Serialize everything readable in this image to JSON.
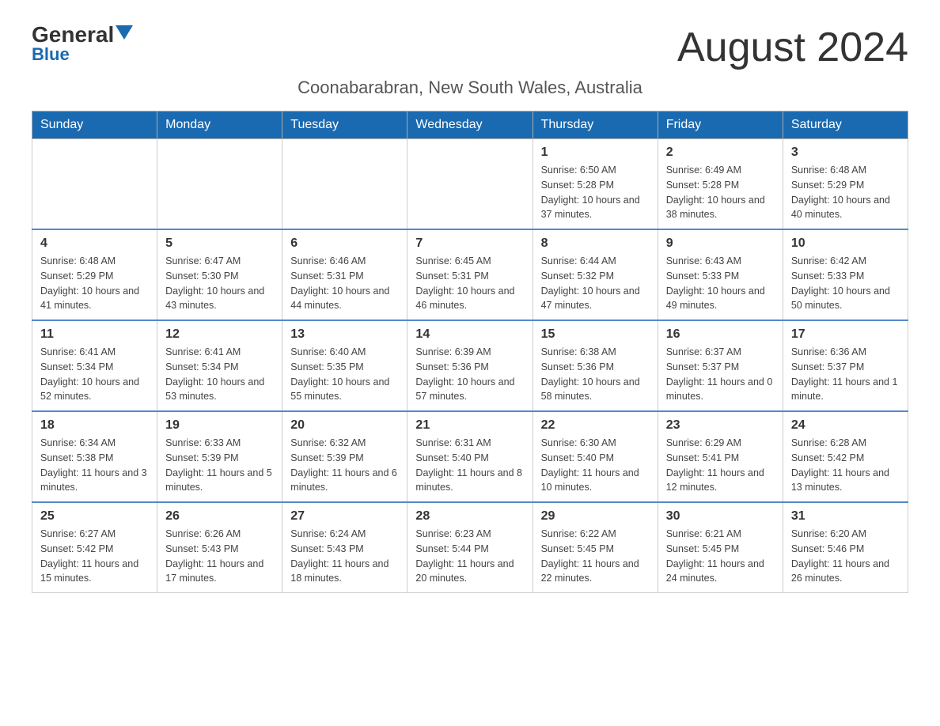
{
  "header": {
    "logo_general": "General",
    "logo_blue": "Blue",
    "month_title": "August 2024",
    "location": "Coonabarabran, New South Wales, Australia"
  },
  "days_of_week": [
    "Sunday",
    "Monday",
    "Tuesday",
    "Wednesday",
    "Thursday",
    "Friday",
    "Saturday"
  ],
  "weeks": [
    [
      {
        "day": "",
        "info": ""
      },
      {
        "day": "",
        "info": ""
      },
      {
        "day": "",
        "info": ""
      },
      {
        "day": "",
        "info": ""
      },
      {
        "day": "1",
        "info": "Sunrise: 6:50 AM\nSunset: 5:28 PM\nDaylight: 10 hours and 37 minutes."
      },
      {
        "day": "2",
        "info": "Sunrise: 6:49 AM\nSunset: 5:28 PM\nDaylight: 10 hours and 38 minutes."
      },
      {
        "day": "3",
        "info": "Sunrise: 6:48 AM\nSunset: 5:29 PM\nDaylight: 10 hours and 40 minutes."
      }
    ],
    [
      {
        "day": "4",
        "info": "Sunrise: 6:48 AM\nSunset: 5:29 PM\nDaylight: 10 hours and 41 minutes."
      },
      {
        "day": "5",
        "info": "Sunrise: 6:47 AM\nSunset: 5:30 PM\nDaylight: 10 hours and 43 minutes."
      },
      {
        "day": "6",
        "info": "Sunrise: 6:46 AM\nSunset: 5:31 PM\nDaylight: 10 hours and 44 minutes."
      },
      {
        "day": "7",
        "info": "Sunrise: 6:45 AM\nSunset: 5:31 PM\nDaylight: 10 hours and 46 minutes."
      },
      {
        "day": "8",
        "info": "Sunrise: 6:44 AM\nSunset: 5:32 PM\nDaylight: 10 hours and 47 minutes."
      },
      {
        "day": "9",
        "info": "Sunrise: 6:43 AM\nSunset: 5:33 PM\nDaylight: 10 hours and 49 minutes."
      },
      {
        "day": "10",
        "info": "Sunrise: 6:42 AM\nSunset: 5:33 PM\nDaylight: 10 hours and 50 minutes."
      }
    ],
    [
      {
        "day": "11",
        "info": "Sunrise: 6:41 AM\nSunset: 5:34 PM\nDaylight: 10 hours and 52 minutes."
      },
      {
        "day": "12",
        "info": "Sunrise: 6:41 AM\nSunset: 5:34 PM\nDaylight: 10 hours and 53 minutes."
      },
      {
        "day": "13",
        "info": "Sunrise: 6:40 AM\nSunset: 5:35 PM\nDaylight: 10 hours and 55 minutes."
      },
      {
        "day": "14",
        "info": "Sunrise: 6:39 AM\nSunset: 5:36 PM\nDaylight: 10 hours and 57 minutes."
      },
      {
        "day": "15",
        "info": "Sunrise: 6:38 AM\nSunset: 5:36 PM\nDaylight: 10 hours and 58 minutes."
      },
      {
        "day": "16",
        "info": "Sunrise: 6:37 AM\nSunset: 5:37 PM\nDaylight: 11 hours and 0 minutes."
      },
      {
        "day": "17",
        "info": "Sunrise: 6:36 AM\nSunset: 5:37 PM\nDaylight: 11 hours and 1 minute."
      }
    ],
    [
      {
        "day": "18",
        "info": "Sunrise: 6:34 AM\nSunset: 5:38 PM\nDaylight: 11 hours and 3 minutes."
      },
      {
        "day": "19",
        "info": "Sunrise: 6:33 AM\nSunset: 5:39 PM\nDaylight: 11 hours and 5 minutes."
      },
      {
        "day": "20",
        "info": "Sunrise: 6:32 AM\nSunset: 5:39 PM\nDaylight: 11 hours and 6 minutes."
      },
      {
        "day": "21",
        "info": "Sunrise: 6:31 AM\nSunset: 5:40 PM\nDaylight: 11 hours and 8 minutes."
      },
      {
        "day": "22",
        "info": "Sunrise: 6:30 AM\nSunset: 5:40 PM\nDaylight: 11 hours and 10 minutes."
      },
      {
        "day": "23",
        "info": "Sunrise: 6:29 AM\nSunset: 5:41 PM\nDaylight: 11 hours and 12 minutes."
      },
      {
        "day": "24",
        "info": "Sunrise: 6:28 AM\nSunset: 5:42 PM\nDaylight: 11 hours and 13 minutes."
      }
    ],
    [
      {
        "day": "25",
        "info": "Sunrise: 6:27 AM\nSunset: 5:42 PM\nDaylight: 11 hours and 15 minutes."
      },
      {
        "day": "26",
        "info": "Sunrise: 6:26 AM\nSunset: 5:43 PM\nDaylight: 11 hours and 17 minutes."
      },
      {
        "day": "27",
        "info": "Sunrise: 6:24 AM\nSunset: 5:43 PM\nDaylight: 11 hours and 18 minutes."
      },
      {
        "day": "28",
        "info": "Sunrise: 6:23 AM\nSunset: 5:44 PM\nDaylight: 11 hours and 20 minutes."
      },
      {
        "day": "29",
        "info": "Sunrise: 6:22 AM\nSunset: 5:45 PM\nDaylight: 11 hours and 22 minutes."
      },
      {
        "day": "30",
        "info": "Sunrise: 6:21 AM\nSunset: 5:45 PM\nDaylight: 11 hours and 24 minutes."
      },
      {
        "day": "31",
        "info": "Sunrise: 6:20 AM\nSunset: 5:46 PM\nDaylight: 11 hours and 26 minutes."
      }
    ]
  ]
}
